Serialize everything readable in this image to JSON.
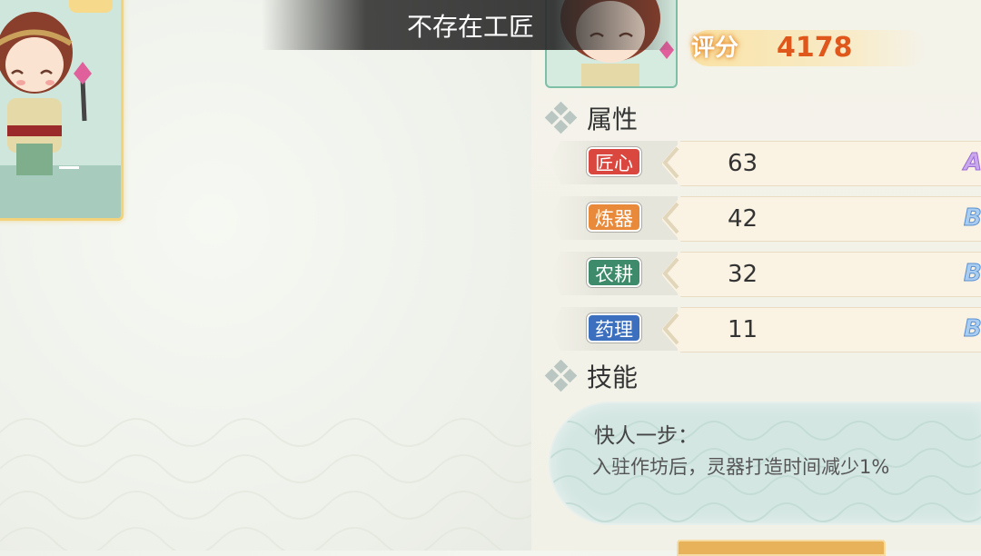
{
  "toast": {
    "text": "不存在工匠"
  },
  "score": {
    "label": "评分",
    "value": "4178"
  },
  "attributes_section": {
    "title": "属性",
    "icon": "diamond-cluster-icon"
  },
  "attributes": [
    {
      "tag": "匠心",
      "value": "63",
      "tag_color": "#d9473e",
      "grade_color": "#b98ae0"
    },
    {
      "tag": "炼器",
      "value": "42",
      "tag_color": "#e98a3b",
      "grade_color": "#6fa8e0"
    },
    {
      "tag": "农耕",
      "value": "32",
      "tag_color": "#3d8b6b",
      "grade_color": "#6fa8e0"
    },
    {
      "tag": "药理",
      "value": "11",
      "tag_color": "#3d6fbf",
      "grade_color": "#6fa8e0"
    }
  ],
  "skills_section": {
    "title": "技能",
    "icon": "diamond-cluster-icon"
  },
  "skill": {
    "name": "快人一步：",
    "description": "入驻作坊后，灵器打造时间减少1%"
  }
}
